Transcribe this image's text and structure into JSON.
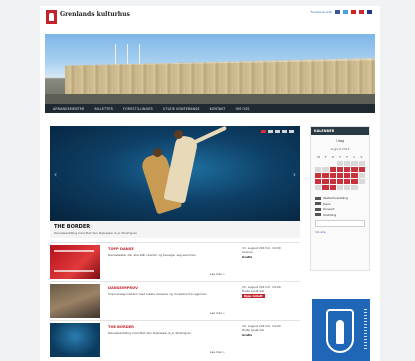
{
  "header": {
    "site_title": "Grenlands kulturhus",
    "site_subtitle": "",
    "top_links": [
      "Facebook-side",
      "",
      ""
    ]
  },
  "nav": {
    "items": [
      "ARRANGEMENTER",
      "BILLETTER",
      "FORESTILLINGER",
      "UTLEIE KONFERANSE",
      "KONTAKT",
      "OM OSS"
    ]
  },
  "slider": {
    "title": "THE BORDER",
    "subtitle": "Dansebestilling med Piet Van Dijsselaar & Jo Strømgren",
    "dots_total": 5,
    "active_dot": 1
  },
  "events": [
    {
      "title": "TOPP DANSE",
      "description": "Danseteater der alle står utenfor og beveger seg sammen",
      "more": "Les mer »",
      "date": "13. august 2013 kl. 19:00",
      "venue": "Scenen",
      "price": "Gratis"
    },
    {
      "title": "DANSEIMPROV",
      "description": "Improvisasjonsdans med lokale dansere og musikere fra regionen",
      "more": "Les mer »",
      "date": "15. august 2013 kl. 19:00",
      "venue": "Hvite Lyset Sal",
      "buy_label": "Kjøp billett"
    },
    {
      "title": "THE BORDER",
      "description": "Dansebestilling med Piet Van Dijsselaar & Jo Strømgren",
      "more": "Les mer »",
      "date": "19. august 2013 kl. 19:00",
      "venue": "Hvite Lyset Sal",
      "price": "Gratis"
    }
  ],
  "calendar": {
    "header": "KALENDER",
    "today_label": "I dag",
    "month_label": "August 2013",
    "weekdays": [
      "M",
      "T",
      "O",
      "T",
      "F",
      "L",
      "S"
    ],
    "event_days": [
      7,
      8,
      9,
      10,
      11,
      12,
      13,
      14,
      15,
      16,
      17,
      19,
      20,
      21,
      22,
      23,
      24,
      27,
      28
    ],
    "legend": [
      "Teaterforestilling",
      "Dans",
      "Konsert",
      "Utstilling"
    ],
    "archive_link": "Vis alle"
  },
  "colors": {
    "brand_red": "#c0242a",
    "nav_dark": "#1f2a30",
    "crest_blue": "#1f66b7"
  }
}
